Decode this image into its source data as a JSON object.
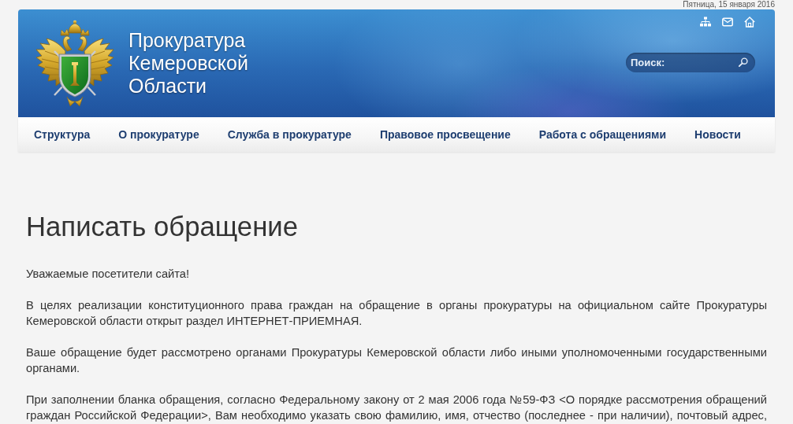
{
  "date": "Пятница, 15 января 2016",
  "header": {
    "title_lines": [
      "Прокуратура",
      "Кемеровской",
      "Области"
    ],
    "search": {
      "placeholder": "Поиск:"
    }
  },
  "nav": [
    {
      "label": "Структура"
    },
    {
      "label": "О прокуратуре"
    },
    {
      "label": "Служба в прокуратуре"
    },
    {
      "label": "Правовое просвещение"
    },
    {
      "label": "Работа с обращениями"
    },
    {
      "label": "Новости"
    }
  ],
  "page": {
    "heading": "Написать обращение",
    "greeting": "Уважаемые посетители сайта!",
    "paragraphs": [
      "В целях реализации конституционного права граждан на обращение в органы прокуратуры на официальном сайте Прокуратуры Кемеровской области открыт раздел ИНТЕРНЕТ-ПРИЕМНАЯ.",
      "Ваше обращение будет рассмотрено органами Прокуратуры Кемеровской области либо иными уполномоченными государственными органами.",
      "При заполнении бланка обращения, согласно Федеральному закону от 2 мая 2006 года №59-ФЗ <О порядке рассмотрения обращений граждан Российской Федерации>, Вам необходимо указать свою фамилию, имя, отчество (последнее - при наличии), почтовый адрес,"
    ]
  }
}
